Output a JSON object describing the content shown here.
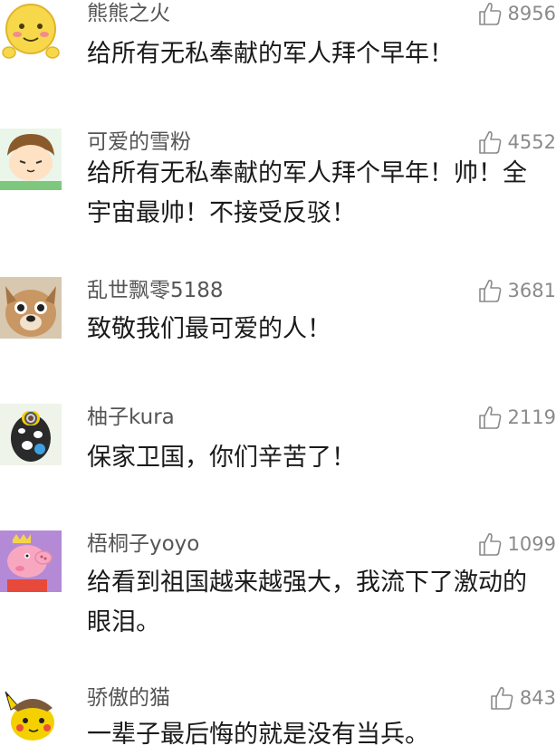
{
  "comments": [
    {
      "user": "熊熊之火",
      "likes": "8956",
      "text": "给所有无私奉献的军人拜个早年！"
    },
    {
      "user": "可爱的雪粉",
      "likes": "4552",
      "text": "给所有无私奉献的军人拜个早年！帅！全宇宙最帅！不接受反驳！"
    },
    {
      "user": "乱世飘零5188",
      "likes": "3681",
      "text": "致敬我们最可爱的人！"
    },
    {
      "user": "柚子kura",
      "likes": "2119",
      "text": "保家卫国，你们辛苦了！"
    },
    {
      "user": "梧桐子yoyo",
      "likes": "1099",
      "text": "给看到祖国越来越强大，我流下了激动的眼泪。"
    },
    {
      "user": "骄傲的猫",
      "likes": "843",
      "text": "一辈子最后悔的就是没有当兵。"
    }
  ],
  "icons": {
    "like": "thumbs-up-icon"
  },
  "colors": {
    "username": "#555555",
    "text": "#1a1a1a",
    "like": "#8a8a8a"
  }
}
